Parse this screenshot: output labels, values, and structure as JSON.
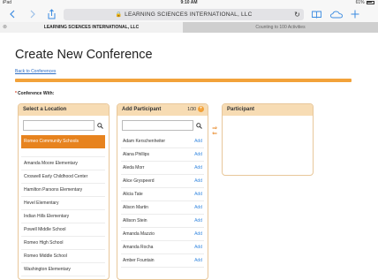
{
  "status_bar": {
    "device": "iPad",
    "time": "9:10 AM",
    "battery": "61%"
  },
  "browser": {
    "url_text": "LEARNING SCIENCES INTERNATIONAL, LLC",
    "tabs": [
      {
        "label": "LEARNING SCIENCES INTERNATIONAL, LLC",
        "active": true
      },
      {
        "label": "Counting to 100 Activities",
        "active": false
      }
    ],
    "accent_color": "#3b8be0"
  },
  "page": {
    "title": "Create New Conference",
    "back_link": "Back to Conferences",
    "required_marker": "*",
    "conference_with_label": "Conference With:"
  },
  "location_panel": {
    "header": "Select a Location",
    "search_value": "",
    "selected": "Romeo Community Schools",
    "items": [
      "Amanda Moore Elementary",
      "Croswell Early Childhood Center",
      "Hamilton Parsons Elementary",
      "Hevel Elementary",
      "Indian Hills Elementary",
      "Powell Middle School",
      "Romeo High School",
      "Romeo Middle School",
      "Washington Elementary"
    ]
  },
  "add_participant_panel": {
    "header": "Add Participant",
    "count": "1/30",
    "search_value": "",
    "add_label": "Add",
    "items": [
      "Adam Kerschenheiter",
      "Alana Phillips",
      "Aleda Morr",
      "Alice Gryspeerd",
      "Alicia Tate",
      "Alison Martin",
      "Allison Stein",
      "Amanda Mazzio",
      "Amanda Rocha",
      "Amber Fountain"
    ]
  },
  "participant_panel": {
    "header": "Participant"
  },
  "colors": {
    "orange": "#f2a23a",
    "selected": "#e7831e",
    "panel_header": "#f7dcb4",
    "link": "#2b6cc4"
  }
}
